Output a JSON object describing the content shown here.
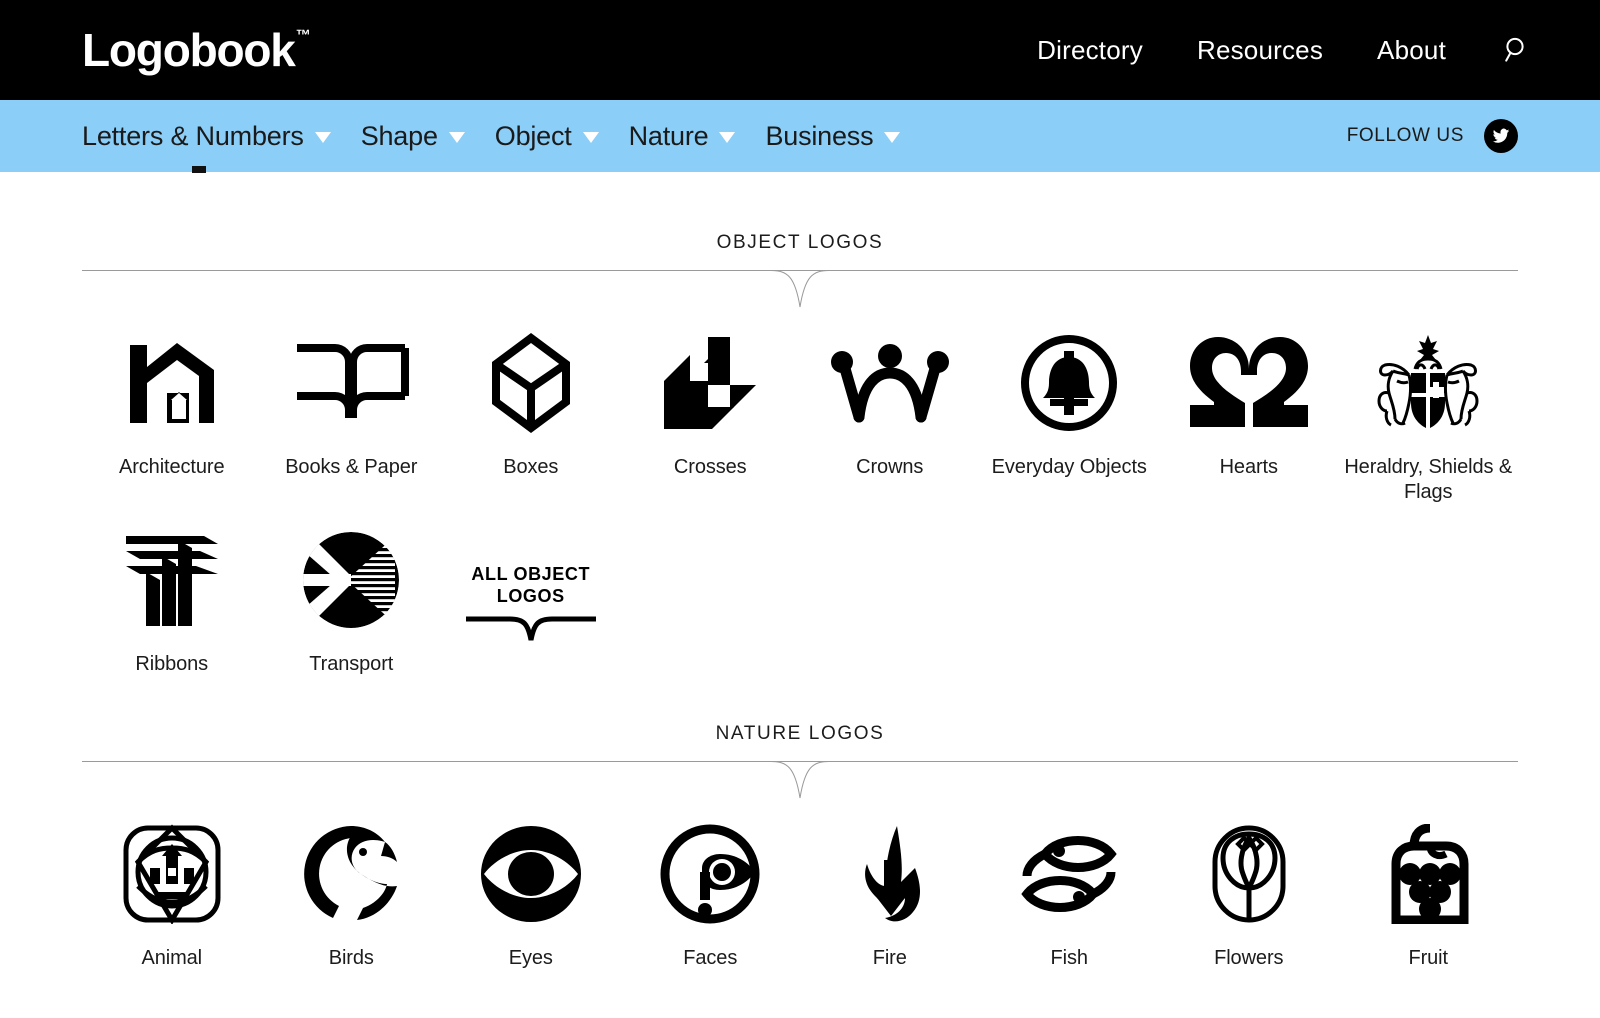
{
  "header": {
    "brand": "Logobook",
    "brand_tm": "™",
    "nav": [
      {
        "label": "Directory"
      },
      {
        "label": "Resources"
      },
      {
        "label": "About"
      }
    ],
    "search_icon": "search-icon"
  },
  "subnav": {
    "items": [
      {
        "label": "Letters & Numbers",
        "caret": "chevron-down-icon"
      },
      {
        "label": "Shape",
        "caret": "chevron-down-icon"
      },
      {
        "label": "Object",
        "caret": "chevron-down-icon"
      },
      {
        "label": "Nature",
        "caret": "chevron-down-icon"
      },
      {
        "label": "Business",
        "caret": "chevron-down-icon"
      }
    ],
    "follow_label": "FOLLOW US",
    "social_icon": "twitter-icon",
    "bar_color": "#8BCEF7",
    "active_item": "Object"
  },
  "sections": [
    {
      "title": "OBJECT LOGOS",
      "items": [
        {
          "label": "Architecture",
          "icon": "architecture-house-icon"
        },
        {
          "label": "Books & Paper",
          "icon": "open-book-icon"
        },
        {
          "label": "Boxes",
          "icon": "cube-box-icon"
        },
        {
          "label": "Crosses",
          "icon": "pinwheel-cross-icon"
        },
        {
          "label": "Crowns",
          "icon": "crown-icon"
        },
        {
          "label": "Everyday Objects",
          "icon": "bell-in-circle-icon"
        },
        {
          "label": "Hearts",
          "icon": "heart-icon"
        },
        {
          "label": "Heraldry, Shields & Flags",
          "icon": "coat-of-arms-icon"
        },
        {
          "label": "Ribbons",
          "icon": "ribbon-stripes-icon"
        },
        {
          "label": "Transport",
          "icon": "airplane-circle-icon"
        }
      ],
      "all_link": {
        "line1": "ALL OBJECT",
        "line2": "LOGOS"
      }
    },
    {
      "title": "NATURE LOGOS",
      "items": [
        {
          "label": "Animal",
          "icon": "lion-head-icon"
        },
        {
          "label": "Birds",
          "icon": "bird-circle-icon"
        },
        {
          "label": "Eyes",
          "icon": "eye-icon"
        },
        {
          "label": "Faces",
          "icon": "face-profile-icon"
        },
        {
          "label": "Fire",
          "icon": "flame-arrow-icon"
        },
        {
          "label": "Fish",
          "icon": "two-fish-icon"
        },
        {
          "label": "Flowers",
          "icon": "tulip-icon"
        },
        {
          "label": "Fruit",
          "icon": "grapes-icon"
        }
      ]
    }
  ],
  "colors": {
    "accent_blue": "#8BCEF7",
    "bar_black": "#000000",
    "text": "#1c1c1c",
    "rule": "#9a9a9a"
  }
}
